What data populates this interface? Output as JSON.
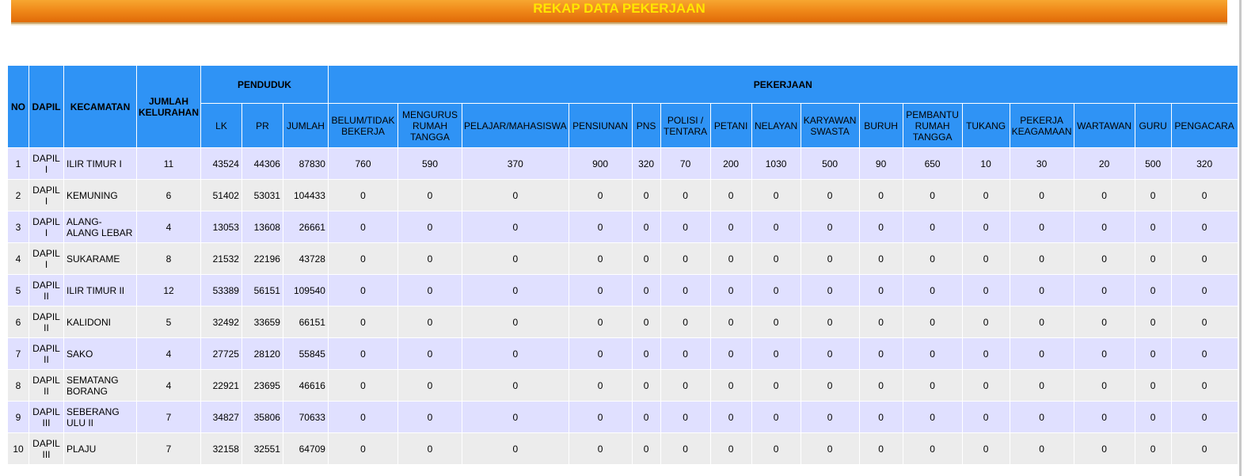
{
  "page": {
    "title": "REKAP DATA PEKERJAAN"
  },
  "table": {
    "headers": {
      "no": "NO",
      "dapil": "DAPIL",
      "kecamatan": "KECAMATAN",
      "jumlah_kelurahan": "JUMLAH KELURAHAN",
      "penduduk": "PENDUDUK",
      "pekerjaan": "PEKERJAAN",
      "lk": "LK",
      "pr": "PR",
      "jumlah": "JUMLAH",
      "jobs": [
        "BELUM/TIDAK BEKERJA",
        "MENGURUS RUMAH TANGGA",
        "PELAJAR/MAHASISWA",
        "PENSIUNAN",
        "PNS",
        "POLISI / TENTARA",
        "PETANI",
        "NELAYAN",
        "KARYAWAN SWASTA",
        "BURUH",
        "PEMBANTU RUMAH TANGGA",
        "TUKANG",
        "PEKERJA KEAGAMAAN",
        "WARTAWAN",
        "GURU",
        "PENGACARA"
      ]
    },
    "rows": [
      {
        "no": "1",
        "dapil": "DAPIL I",
        "kecamatan": "ILIR TIMUR I",
        "kel": "11",
        "lk": "43524",
        "pr": "44306",
        "jumlah": "87830",
        "jobs": [
          "760",
          "590",
          "370",
          "900",
          "320",
          "70",
          "200",
          "1030",
          "500",
          "90",
          "650",
          "10",
          "30",
          "20",
          "500",
          "320"
        ]
      },
      {
        "no": "2",
        "dapil": "DAPIL I",
        "kecamatan": "KEMUNING",
        "kel": "6",
        "lk": "51402",
        "pr": "53031",
        "jumlah": "104433",
        "jobs": [
          "0",
          "0",
          "0",
          "0",
          "0",
          "0",
          "0",
          "0",
          "0",
          "0",
          "0",
          "0",
          "0",
          "0",
          "0",
          "0"
        ]
      },
      {
        "no": "3",
        "dapil": "DAPIL I",
        "kecamatan": "ALANG-ALANG LEBAR",
        "kel": "4",
        "lk": "13053",
        "pr": "13608",
        "jumlah": "26661",
        "jobs": [
          "0",
          "0",
          "0",
          "0",
          "0",
          "0",
          "0",
          "0",
          "0",
          "0",
          "0",
          "0",
          "0",
          "0",
          "0",
          "0"
        ]
      },
      {
        "no": "4",
        "dapil": "DAPIL I",
        "kecamatan": "SUKARAME",
        "kel": "8",
        "lk": "21532",
        "pr": "22196",
        "jumlah": "43728",
        "jobs": [
          "0",
          "0",
          "0",
          "0",
          "0",
          "0",
          "0",
          "0",
          "0",
          "0",
          "0",
          "0",
          "0",
          "0",
          "0",
          "0"
        ]
      },
      {
        "no": "5",
        "dapil": "DAPIL II",
        "kecamatan": "ILIR TIMUR II",
        "kel": "12",
        "lk": "53389",
        "pr": "56151",
        "jumlah": "109540",
        "jobs": [
          "0",
          "0",
          "0",
          "0",
          "0",
          "0",
          "0",
          "0",
          "0",
          "0",
          "0",
          "0",
          "0",
          "0",
          "0",
          "0"
        ]
      },
      {
        "no": "6",
        "dapil": "DAPIL II",
        "kecamatan": "KALIDONI",
        "kel": "5",
        "lk": "32492",
        "pr": "33659",
        "jumlah": "66151",
        "jobs": [
          "0",
          "0",
          "0",
          "0",
          "0",
          "0",
          "0",
          "0",
          "0",
          "0",
          "0",
          "0",
          "0",
          "0",
          "0",
          "0"
        ]
      },
      {
        "no": "7",
        "dapil": "DAPIL II",
        "kecamatan": "SAKO",
        "kel": "4",
        "lk": "27725",
        "pr": "28120",
        "jumlah": "55845",
        "jobs": [
          "0",
          "0",
          "0",
          "0",
          "0",
          "0",
          "0",
          "0",
          "0",
          "0",
          "0",
          "0",
          "0",
          "0",
          "0",
          "0"
        ]
      },
      {
        "no": "8",
        "dapil": "DAPIL II",
        "kecamatan": "SEMATANG BORANG",
        "kel": "4",
        "lk": "22921",
        "pr": "23695",
        "jumlah": "46616",
        "jobs": [
          "0",
          "0",
          "0",
          "0",
          "0",
          "0",
          "0",
          "0",
          "0",
          "0",
          "0",
          "0",
          "0",
          "0",
          "0",
          "0"
        ]
      },
      {
        "no": "9",
        "dapil": "DAPIL III",
        "kecamatan": "SEBERANG ULU II",
        "kel": "7",
        "lk": "34827",
        "pr": "35806",
        "jumlah": "70633",
        "jobs": [
          "0",
          "0",
          "0",
          "0",
          "0",
          "0",
          "0",
          "0",
          "0",
          "0",
          "0",
          "0",
          "0",
          "0",
          "0",
          "0"
        ]
      },
      {
        "no": "10",
        "dapil": "DAPIL III",
        "kecamatan": "PLAJU",
        "kel": "7",
        "lk": "32158",
        "pr": "32551",
        "jumlah": "64709",
        "jobs": [
          "0",
          "0",
          "0",
          "0",
          "0",
          "0",
          "0",
          "0",
          "0",
          "0",
          "0",
          "0",
          "0",
          "0",
          "0",
          "0"
        ]
      }
    ]
  },
  "colors": {
    "title_bar": "#f08a1a",
    "title_text": "#ffe600",
    "header_bg": "#2f93f5",
    "row_odd": "#e0e0ff",
    "row_even": "#ececec"
  }
}
